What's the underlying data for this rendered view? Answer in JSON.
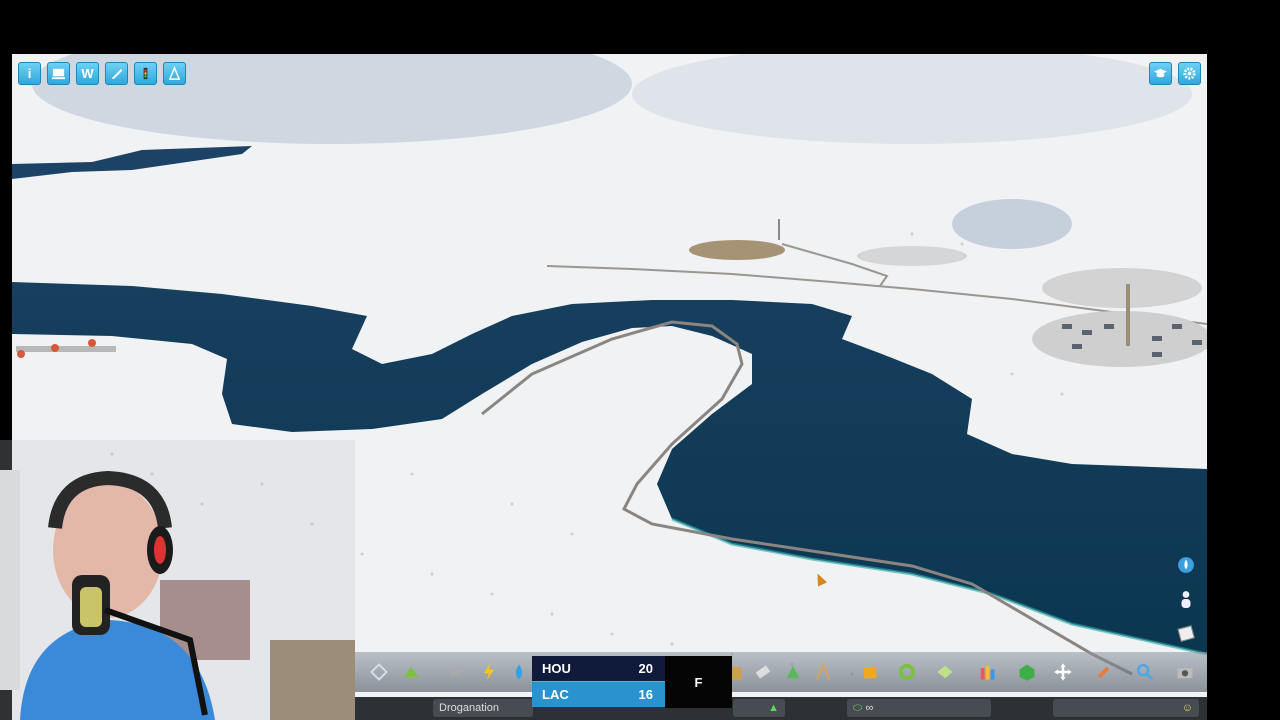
{
  "hud": {
    "top_left_buttons": [
      {
        "name": "info-icon",
        "glyph": "i"
      },
      {
        "name": "chirper-icon",
        "glyph": ""
      },
      {
        "name": "workshop-icon",
        "glyph": "W"
      },
      {
        "name": "unlock-icon",
        "glyph": ""
      },
      {
        "name": "traffic-light-icon",
        "glyph": ""
      },
      {
        "name": "cone-icon",
        "glyph": ""
      }
    ],
    "top_right_buttons": [
      {
        "name": "graduation-cap-icon"
      },
      {
        "name": "gear-icon"
      }
    ],
    "side_tools": [
      "water-drop-icon",
      "person-icon",
      "notepad-icon"
    ]
  },
  "scoreboard": {
    "home": {
      "team": "HOU",
      "score": "20"
    },
    "away": {
      "team": "LAC",
      "score": "16"
    },
    "period": "F"
  },
  "statusbar": {
    "city_name": "Droganation",
    "money_label": "∞",
    "speed_indicator": "▲"
  },
  "toolbar": {
    "tools": [
      "zoning-diamond-icon",
      "district-icon",
      "road-icon",
      "electricity-icon",
      "water-icon",
      "garbage-icon",
      "healthcare-icon",
      "fire-icon",
      "police-icon",
      "education-icon",
      "transport-icon",
      "parks-icon",
      "unique-buildings-icon",
      "monuments-icon",
      "wonders-icon",
      "decoration-icon",
      "move-icon",
      "bulldozer-icon",
      "search-icon",
      "camera-icon"
    ]
  },
  "colors": {
    "ui_blue": "#2fa7dd",
    "water": "#0f3b5a",
    "snow": "#f2f3f4",
    "road": "#8a8580",
    "score_home_bg": "#101a3a",
    "score_away_bg": "#2a93cf"
  }
}
